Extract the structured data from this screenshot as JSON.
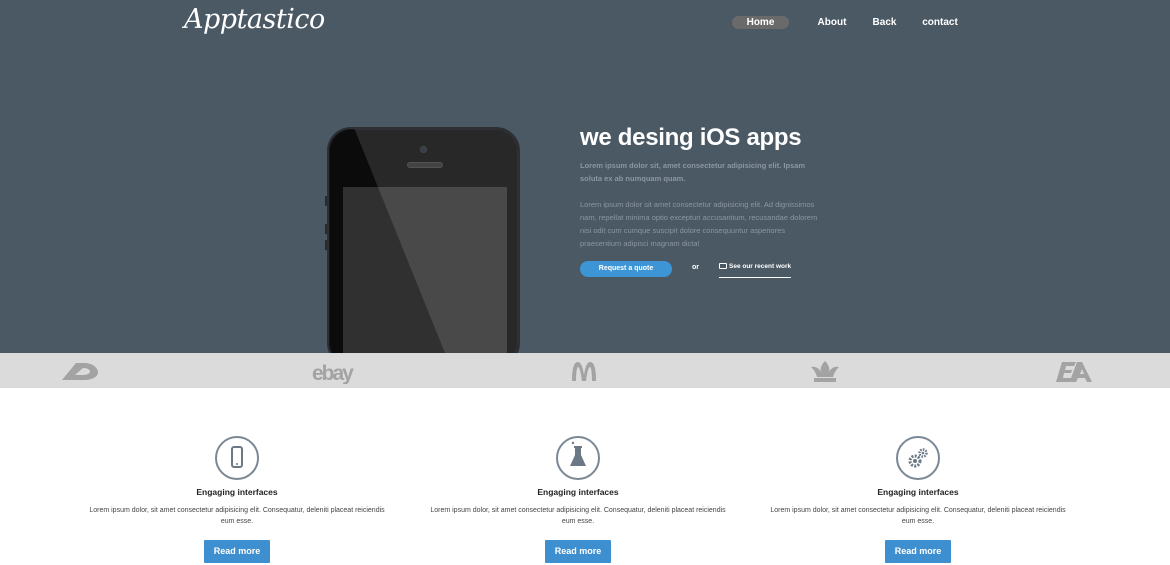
{
  "logo": "Apptastico",
  "nav": [
    {
      "label": "Home",
      "active": true
    },
    {
      "label": "About",
      "active": false
    },
    {
      "label": "Back",
      "active": false
    },
    {
      "label": "contact",
      "active": false
    }
  ],
  "hero": {
    "headline": "we desing iOS apps",
    "lead": "Lorem ipsum dolor sit, amet consectetur adipisicing elit. Ipsam soluta ex ab numquam quam.",
    "body": "Lorem ipsum dolor sit amet consectetur adipisicing elit. Ad dignissimos nam, repellat minima optio excepturi accusantium, recusandae dolorem nisi odit cum cumque suscipit dolore consequuntur asperiores praesentium adipisci magnam dicta!",
    "quote_button": "Request a quote",
    "or": "or",
    "work_link": "See our recent work"
  },
  "brands": [
    "deviantart-logo",
    "ebay-logo",
    "mcdonalds-logo",
    "adidas-logo",
    "ea-logo"
  ],
  "features": [
    {
      "icon": "phone-icon",
      "title": "Engaging interfaces",
      "text": "Lorem ipsum dolor, sit amet consectetur adipisicing elit. Consequatur, deleniti placeat reiciendis eum esse.",
      "button": "Read more"
    },
    {
      "icon": "flask-icon",
      "title": "Engaging interfaces",
      "text": "Lorem ipsum dolor, sit amet consectetur adipisicing elit. Consequatur, deleniti placeat reiciendis eum esse.",
      "button": "Read more"
    },
    {
      "icon": "gears-icon",
      "title": "Engaging interfaces",
      "text": "Lorem ipsum dolor, sit amet consectetur adipisicing elit. Consequatur, deleniti placeat reiciendis eum esse.",
      "button": "Read more"
    }
  ],
  "colors": {
    "hero_bg": "#4b5965",
    "accent": "#3e95d6",
    "brand_strip": "#dbdbdb"
  }
}
